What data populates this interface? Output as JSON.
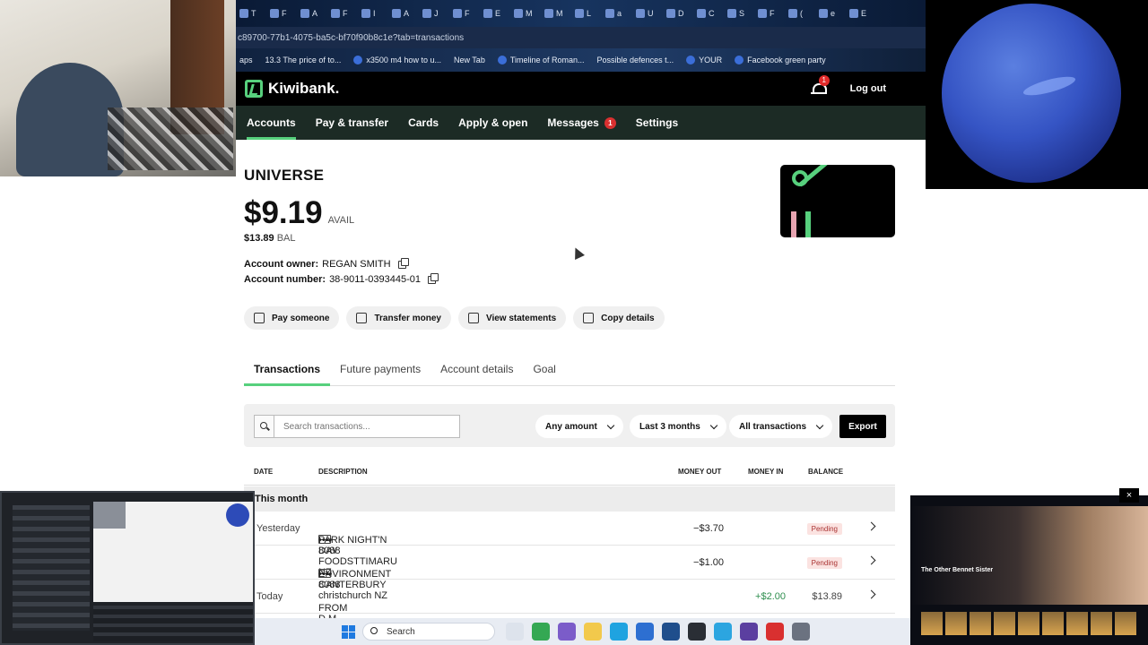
{
  "browser": {
    "url": "c89700-77b1-4075-ba5c-bf70f90b8c1e?tab=transactions",
    "tabs": [
      "T",
      "F",
      "A",
      "F",
      "I",
      "A",
      "J",
      "F",
      "E",
      "M",
      "M",
      "L",
      "a",
      "U",
      "D",
      "C",
      "S",
      "F",
      "(",
      "e",
      "E"
    ],
    "bookmarks": [
      "aps",
      "13.3 The price of to...",
      "x3500 m4 how to u...",
      "New Tab",
      "Timeline of Roman...",
      "Possible defences t...",
      "YOUR",
      "Facebook green party"
    ]
  },
  "kiwibank": {
    "brand": "Kiwibank.",
    "notifications_count": "1",
    "logout": "Log out",
    "nav": [
      {
        "label": "Accounts"
      },
      {
        "label": "Pay & transfer"
      },
      {
        "label": "Cards"
      },
      {
        "label": "Apply & open"
      },
      {
        "label": "Messages",
        "badge": "1"
      },
      {
        "label": "Settings"
      }
    ]
  },
  "account": {
    "name": "UNIVERSE",
    "available": "$9.19",
    "available_label": "AVAIL",
    "balance": "$13.89",
    "balance_label": "BAL",
    "owner_label": "Account owner:",
    "owner": "REGAN SMITH",
    "number_label": "Account number:",
    "number": "38-9011-0393445-01"
  },
  "actions": [
    "Pay someone",
    "Transfer money",
    "View statements",
    "Copy details"
  ],
  "tabs": [
    "Transactions",
    "Future payments",
    "Account details",
    "Goal"
  ],
  "filters": {
    "search_placeholder": "Search transactions...",
    "amount": "Any amount",
    "period": "Last 3 months",
    "type": "All transactions",
    "export": "Export"
  },
  "table": {
    "headers": [
      "DATE",
      "DESCRIPTION",
      "MONEY OUT",
      "MONEY IN",
      "BALANCE"
    ],
    "group": "This month",
    "rows": [
      {
        "date": "Yesterday",
        "description": "PARK NIGHT'N DAY FOODSTTIMARU NZ",
        "card": "•••• 8088",
        "out": "−$3.70",
        "in": "",
        "balance": "",
        "status": "Pending"
      },
      {
        "date": "",
        "description": "ENVIRONMENT CANTERBURY christchurch NZ",
        "card": "•••• 8088",
        "out": "−$1.00",
        "in": "",
        "balance": "",
        "status": "Pending"
      },
      {
        "date": "Today",
        "description": "FROM D M BURNS",
        "card": "",
        "out": "",
        "in": "+$2.00",
        "balance": "$13.89",
        "status": ""
      }
    ]
  },
  "overlay": {
    "tv_title": "The Other Bennet Sister"
  },
  "taskbar": {
    "search": "Search"
  }
}
